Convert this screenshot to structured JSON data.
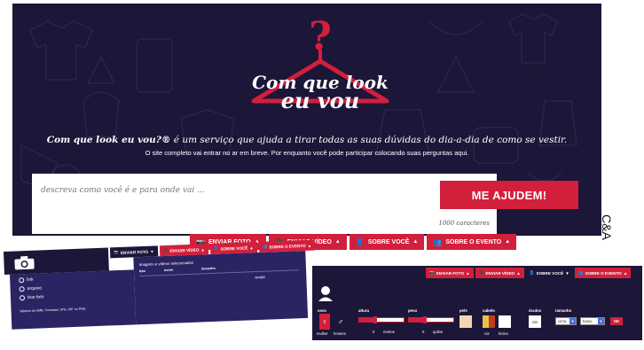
{
  "hero": {
    "logo_line1": "Com que look",
    "logo_line2": "eu vou",
    "logo_mark": "?",
    "tagline_bold": "Com que look eu vou?®",
    "tagline_rest": " é um serviço que ajuda a tirar todas as suas dúvidas do dia-a-dia de como se vestir.",
    "subline": "O site completo vai entrar no ar em breve. Por enquanto você pode participar colocando suas perguntas aqui."
  },
  "form": {
    "placeholder": "descreva como você é e para onde vai ...",
    "counter": "1000 caracteres",
    "submit_label": "ME AJUDEM!"
  },
  "tabs": [
    {
      "label": "ENVIAR FOTO",
      "icon": "camera-icon",
      "glyph": "📷"
    },
    {
      "label": "ENVIAR VÍDEO",
      "icon": "video-icon",
      "glyph": "🎥"
    },
    {
      "label": "SOBRE VOCÊ",
      "icon": "user-icon",
      "glyph": "👤"
    },
    {
      "label": "SOBRE O EVENTO",
      "icon": "group-icon",
      "glyph": "👥"
    }
  ],
  "caret": "▲",
  "caret_down": "▼",
  "brand": "C&A",
  "photo_panel": {
    "options": [
      "link",
      "arquivo",
      "tirar foto"
    ],
    "note": "Máximo de 5MB. Formatos: JPG, GIF ou PNG",
    "selected_title": "Imagens e vídeos selecionados",
    "columns": [
      "tipo",
      "nome",
      "tamanho"
    ],
    "delete_label": "apagar"
  },
  "about_panel": {
    "sexo_label": "sexo",
    "sexo_options": [
      "mulher",
      "homem"
    ],
    "altura_label": "altura",
    "altura_value": "0",
    "altura_unit": "metros",
    "altura_fraction": 0.35,
    "peso_label": "peso",
    "peso_value": "0",
    "peso_unit": "quilos",
    "peso_fraction": 0.35,
    "pele_label": "pele",
    "cabelo_label": "cabelo",
    "cabelo_sub": [
      "cor",
      "forma"
    ],
    "oculos_label": "óculos",
    "oculos_value": "sim",
    "tamanho_label": "tamanho",
    "tamanho_options": [
      "cima",
      "baixo"
    ],
    "ok_label": "OK"
  },
  "colors": {
    "navy": "#1c1638",
    "accent_red": "#d21f3b",
    "panel_blue": "#2a2462"
  }
}
